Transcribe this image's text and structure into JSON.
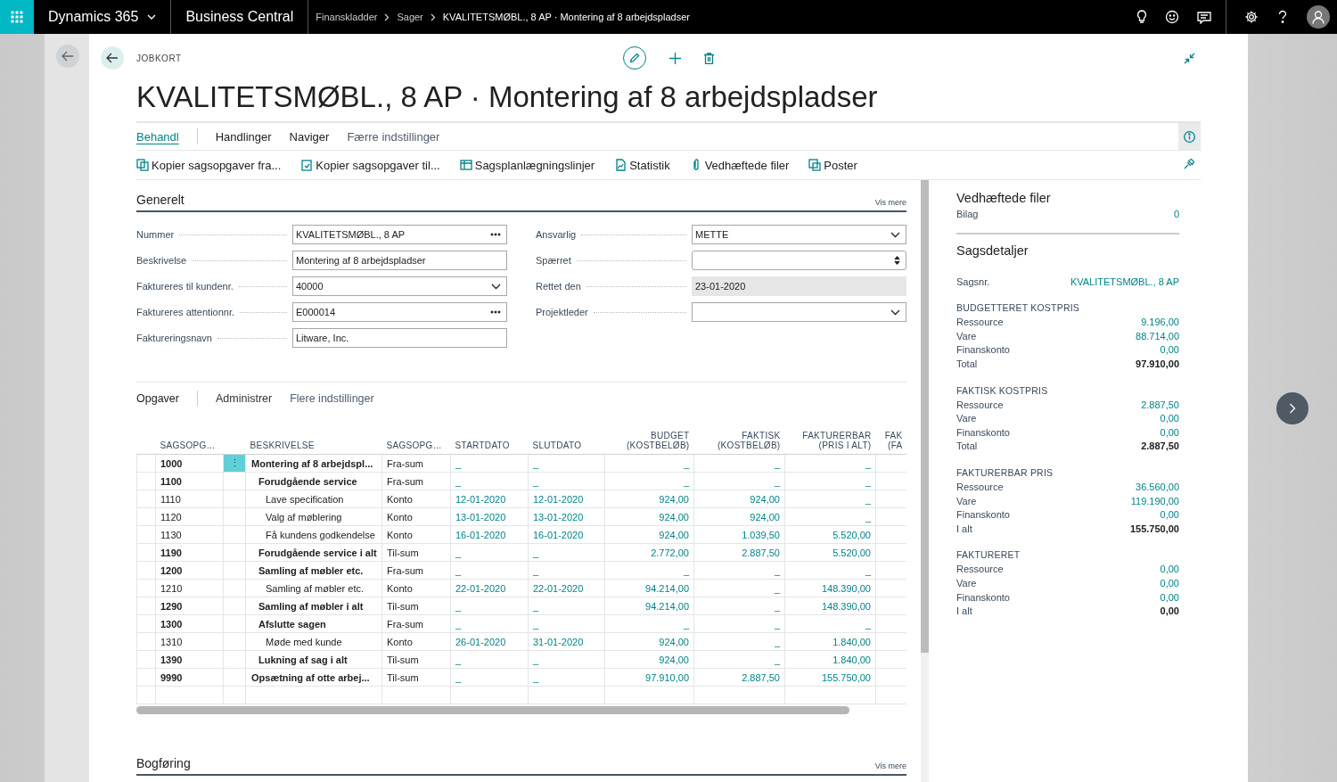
{
  "app_bar": {
    "app_name": "Dynamics 365",
    "product": "Business Central",
    "breadcrumbs": [
      "Finanskladder",
      "Sager",
      "KVALITETSMØBL., 8 AP · Montering af 8 arbejdspladser"
    ]
  },
  "page": {
    "caption": "JOBKORT",
    "title": "KVALITETSMØBL., 8 AP · Montering af 8 arbejdspladser"
  },
  "action_tabs": [
    {
      "label": "Behandl",
      "selected": true
    },
    {
      "label": "Handlinger",
      "selected": false
    },
    {
      "label": "Naviger",
      "selected": false
    }
  ],
  "less_options": "Færre indstillinger",
  "actions": [
    {
      "label": "Kopier sagsopgaver fra...",
      "kind": "copy-from"
    },
    {
      "label": "Kopier sagsopgaver til...",
      "kind": "copy-to"
    },
    {
      "label": "Sagsplanlægningslinjer",
      "kind": "planning"
    },
    {
      "label": "Statistik",
      "kind": "statistics"
    },
    {
      "label": "Vedhæftede filer",
      "kind": "attachments"
    },
    {
      "label": "Poster",
      "kind": "entries"
    }
  ],
  "general": {
    "title": "Generelt",
    "show_more": "Vis mere",
    "left_fields": [
      {
        "label": "Nummer",
        "value": "KVALITETSMØBL., 8 AP",
        "kind": "lookup"
      },
      {
        "label": "Beskrivelse",
        "value": "Montering af 8 arbejdspladser",
        "kind": "text"
      },
      {
        "label": "Faktureres til kundenr.",
        "value": "40000",
        "kind": "dropdown"
      },
      {
        "label": "Faktureres attentionnr.",
        "value": "E000014",
        "kind": "lookup"
      },
      {
        "label": "Faktureringsnavn",
        "value": "Litware, Inc.",
        "kind": "text"
      }
    ],
    "right_fields": [
      {
        "label": "Ansvarlig",
        "value": "METTE",
        "kind": "dropdown"
      },
      {
        "label": "Spærret",
        "kind": "select"
      },
      {
        "label": "Rettet den",
        "value": "23-01-2020",
        "kind": "readonly"
      },
      {
        "label": "Projektleder",
        "kind": "dropdown"
      }
    ]
  },
  "lines": {
    "title": "Opgaver",
    "menu": "Administrer",
    "more_options": "Flere indstillinger",
    "row_menu_icon": "⋮",
    "columns": [
      "SAGSOPG…",
      "BESKRIVELSE",
      "SAGSOPG…",
      "STARTDATO",
      "SLUTDATO",
      "BUDGET\n(KOSTBELØB)",
      "FAKTISK\n(KOSTBELØB)",
      "FAKTURERBAR\n(PRIS I ALT)",
      "FAK\n(FA"
    ],
    "rows": [
      {
        "no": "1000",
        "description": "Montering af 8 arbejdspl...",
        "type": "Fra-sum",
        "start": "_",
        "end": "_",
        "budget": "_",
        "actual": "_",
        "billable": "_",
        "kind": "heading",
        "selected": true,
        "children": [
          {
            "no": "1100",
            "description": "Forudgående service",
            "type": "Fra-sum",
            "start": "_",
            "end": "_",
            "budget": "_",
            "actual": "_",
            "billable": "_",
            "kind": "heading",
            "selected": false,
            "children": [
              {
                "no": "1110",
                "description": "Lave specification",
                "type": "Konto",
                "start": "12-01-2020",
                "end": "12-01-2020",
                "budget": "924,00",
                "actual": "924,00",
                "billable": "_",
                "kind": "posting",
                "selected": false
              },
              {
                "no": "1120",
                "description": "Valg af møblering",
                "type": "Konto",
                "start": "13-01-2020",
                "end": "13-01-2020",
                "budget": "924,00",
                "actual": "924,00",
                "billable": "_",
                "kind": "posting",
                "selected": false
              },
              {
                "no": "1130",
                "description": "Få kundens godkendelse",
                "type": "Konto",
                "start": "16-01-2020",
                "end": "16-01-2020",
                "budget": "924,00",
                "actual": "1.039,50",
                "billable": "5.520,00",
                "kind": "posting",
                "selected": false
              }
            ]
          },
          {
            "no": "1190",
            "description": "Forudgående service i alt",
            "type": "Til-sum",
            "start": "_",
            "end": "_",
            "budget": "2.772,00",
            "actual": "2.887,50",
            "billable": "5.520,00",
            "kind": "heading",
            "selected": false
          },
          {
            "no": "1200",
            "description": "Samling af møbler etc.",
            "type": "Fra-sum",
            "start": "_",
            "end": "_",
            "budget": "_",
            "actual": "_",
            "billable": "_",
            "kind": "heading",
            "selected": false,
            "children": [
              {
                "no": "1210",
                "description": "Samling af møbler etc.",
                "type": "Konto",
                "start": "22-01-2020",
                "end": "22-01-2020",
                "budget": "94.214,00",
                "actual": "_",
                "billable": "148.390,00",
                "kind": "posting",
                "selected": false
              }
            ]
          },
          {
            "no": "1290",
            "description": "Samling af møbler i alt",
            "type": "Til-sum",
            "start": "_",
            "end": "_",
            "budget": "94.214,00",
            "actual": "_",
            "billable": "148.390,00",
            "kind": "heading",
            "selected": false
          },
          {
            "no": "1300",
            "description": "Afslutte sagen",
            "type": "Fra-sum",
            "start": "_",
            "end": "_",
            "budget": "_",
            "actual": "_",
            "billable": "_",
            "kind": "heading",
            "selected": false,
            "children": [
              {
                "no": "1310",
                "description": "Møde med kunde",
                "type": "Konto",
                "start": "26-01-2020",
                "end": "31-01-2020",
                "budget": "924,00",
                "actual": "_",
                "billable": "1.840,00",
                "kind": "posting",
                "selected": false
              }
            ]
          },
          {
            "no": "1390",
            "description": "Lukning af sag i alt",
            "type": "Til-sum",
            "start": "_",
            "end": "_",
            "budget": "924,00",
            "actual": "_",
            "billable": "1.840,00",
            "kind": "heading",
            "selected": false
          }
        ]
      },
      {
        "no": "9990",
        "description": "Opsætning af otte arbej...",
        "type": "Til-sum",
        "start": "_",
        "end": "_",
        "budget": "97.910,00",
        "actual": "2.887,50",
        "billable": "155.750,00",
        "kind": "heading",
        "selected": false
      }
    ]
  },
  "posting": {
    "title": "Bogføring",
    "show_more": "Vis mere"
  },
  "factbox": {
    "attachments": {
      "title": "Vedhæftede filer",
      "label": "Bilag",
      "value": "0"
    },
    "details": {
      "title": "Sagsdetaljer",
      "job_label": "Sagsnr.",
      "job_value": "KVALITETSMØBL., 8 AP",
      "groups": [
        {
          "title": "BUDGETTERET KOSTPRIS",
          "lines": [
            {
              "label": "Ressource",
              "value": "9.196,00",
              "kind": "link"
            },
            {
              "label": "Vare",
              "value": "88.714,00",
              "kind": "link"
            },
            {
              "label": "Finanskonto",
              "value": "0,00",
              "kind": "link"
            },
            {
              "label": "Total",
              "value": "97.910,00",
              "kind": "total"
            }
          ]
        },
        {
          "title": "FAKTISK KOSTPRIS",
          "lines": [
            {
              "label": "Ressource",
              "value": "2.887,50",
              "kind": "link"
            },
            {
              "label": "Vare",
              "value": "0,00",
              "kind": "link"
            },
            {
              "label": "Finanskonto",
              "value": "0,00",
              "kind": "link"
            },
            {
              "label": "Total",
              "value": "2.887,50",
              "kind": "total"
            }
          ]
        },
        {
          "title": "FAKTURERBAR PRIS",
          "lines": [
            {
              "label": "Ressource",
              "value": "36.560,00",
              "kind": "link"
            },
            {
              "label": "Vare",
              "value": "119.190,00",
              "kind": "link"
            },
            {
              "label": "Finanskonto",
              "value": "0,00",
              "kind": "link"
            },
            {
              "label": "I alt",
              "value": "155.750,00",
              "kind": "total"
            }
          ]
        },
        {
          "title": "FAKTURERET",
          "lines": [
            {
              "label": "Ressource",
              "value": "0,00",
              "kind": "link"
            },
            {
              "label": "Vare",
              "value": "0,00",
              "kind": "link"
            },
            {
              "label": "Finanskonto",
              "value": "0,00",
              "kind": "link"
            },
            {
              "label": "I alt",
              "value": "0,00",
              "kind": "total"
            }
          ]
        }
      ]
    }
  }
}
